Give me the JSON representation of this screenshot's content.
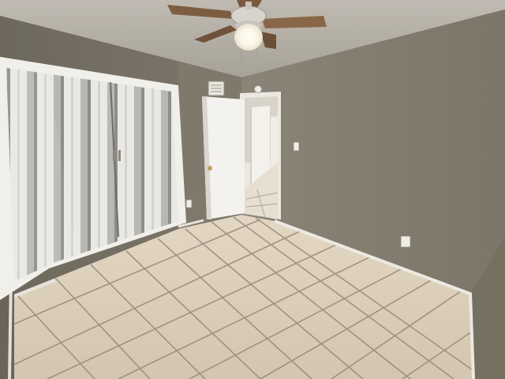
{
  "scene": {
    "subject": "empty-bedroom",
    "features": [
      "ceiling-fan",
      "folding-closet-door",
      "open-door",
      "tile-floor",
      "wall-outlet",
      "light-switch",
      "air-vent"
    ]
  },
  "colors": {
    "wall_left": "#7a7466",
    "wall_right": "#847e71",
    "wall_back": "#8a8476",
    "ceiling": "#b3aea6",
    "floor_tile": "#d9cdb8",
    "grout": "#8f8574",
    "baseboard": "#e8e5de",
    "door": "#f1f0ec",
    "closet_stripe_light": "#ecebe6",
    "closet_stripe_dark": "#9c9a94",
    "fan_blade": "#7a5a3e",
    "light_glow": "#fffdf4"
  }
}
